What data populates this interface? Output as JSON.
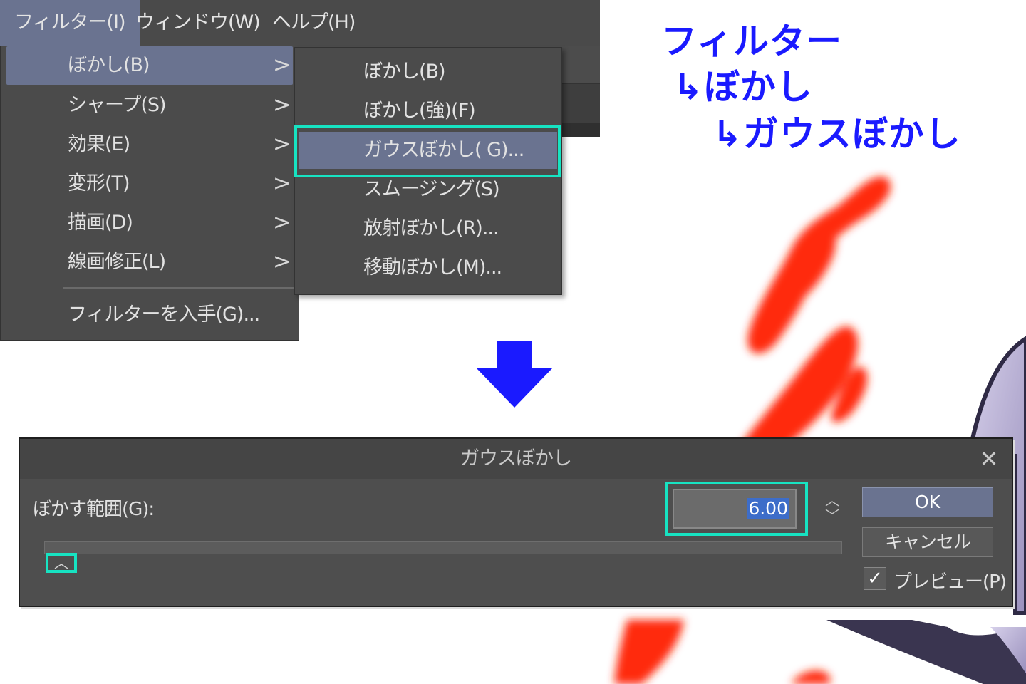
{
  "menubar": {
    "filter": "フィルター(I)",
    "window": "ウィンドウ(W)",
    "help": "ヘルプ(H)"
  },
  "filter_menu": {
    "items": [
      {
        "label": "ぼかし(B)",
        "has_submenu": true
      },
      {
        "label": "シャープ(S)",
        "has_submenu": true
      },
      {
        "label": "効果(E)",
        "has_submenu": true
      },
      {
        "label": "変形(T)",
        "has_submenu": true
      },
      {
        "label": "描画(D)",
        "has_submenu": true
      },
      {
        "label": "線画修正(L)",
        "has_submenu": true
      },
      {
        "label": "フィルターを入手(G)...",
        "has_submenu": false
      }
    ],
    "chevron": ">"
  },
  "blur_menu": {
    "items": [
      {
        "label": "ぼかし(B)"
      },
      {
        "label": "ぼかし(強)(F)"
      },
      {
        "label": "ガウスぼかし( G)..."
      },
      {
        "label": "スムージング(S)"
      },
      {
        "label": "放射ぼかし(R)..."
      },
      {
        "label": "移動ぼかし(M)..."
      }
    ]
  },
  "annotation": {
    "line1": "フィルター",
    "line2": "↳ぼかし",
    "line3": "↳ガウスぼかし"
  },
  "dialog": {
    "title": "ガウスぼかし",
    "close": "✕",
    "blur_range_label": "ぼかす範囲(G):",
    "blur_range_value": "6.00",
    "spin_up": "︿",
    "spin_down": "﹀",
    "slider_thumb": "︿",
    "ok": "OK",
    "cancel": "キャンセル",
    "preview_label": "プレビュー(P)",
    "preview_checked": "✓"
  },
  "colors": {
    "highlight": "#17e3c2",
    "menu_bg": "#4b4b4b",
    "selected": "#6a7390",
    "annotation": "#1a1aff",
    "brush": "#ff2a10"
  }
}
